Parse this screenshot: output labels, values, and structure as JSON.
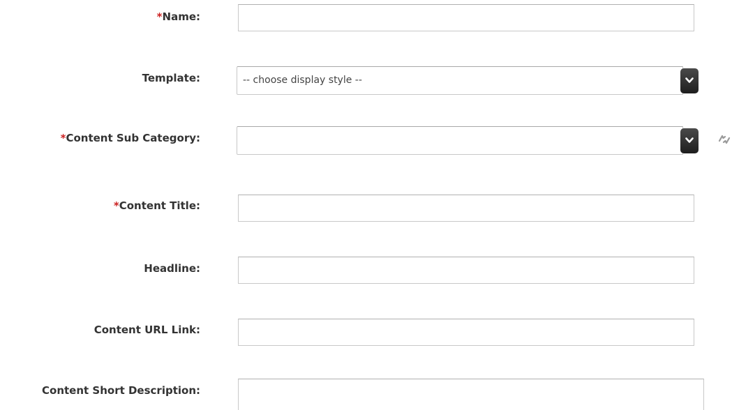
{
  "form": {
    "name": {
      "required_mark": "*",
      "label": "Name:",
      "value": ""
    },
    "template": {
      "label": "Template:",
      "selected": "-- choose display style --"
    },
    "content_sub_category": {
      "required_mark": "*",
      "label": "Content Sub Category:",
      "selected": ""
    },
    "content_title": {
      "required_mark": "*",
      "label": "Content Title:",
      "value": ""
    },
    "headline": {
      "label": "Headline:",
      "value": ""
    },
    "content_url_link": {
      "label": "Content URL Link:",
      "value": ""
    },
    "content_short_description": {
      "label": "Content Short Description:",
      "value": ""
    }
  },
  "icons": {
    "dropdown_arrow": "chevron-down-icon",
    "refresh": "refresh-icon"
  },
  "colors": {
    "required": "#cc2222",
    "label_text": "#333333",
    "border": "#c8c8c8",
    "arrow_bg": "#2a2a2a"
  }
}
